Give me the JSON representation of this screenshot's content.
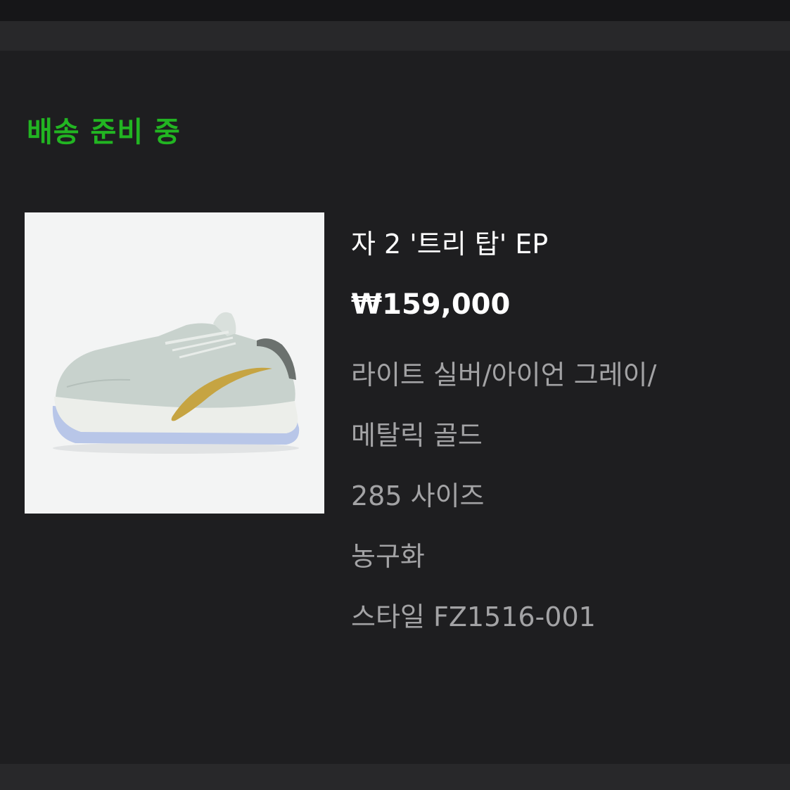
{
  "order": {
    "status": "배송 준비 중",
    "status_color": "#22b522"
  },
  "product": {
    "image_icon": "sneaker-image",
    "name": "자 2 '트리 탑' EP",
    "price": "₩159,000",
    "color_line1": "라이트 실버/아이언 그레이/",
    "color_line2": "메탈릭 골드",
    "size": "285 사이즈",
    "category": "농구화",
    "style": "스타일 FZ1516-001"
  }
}
